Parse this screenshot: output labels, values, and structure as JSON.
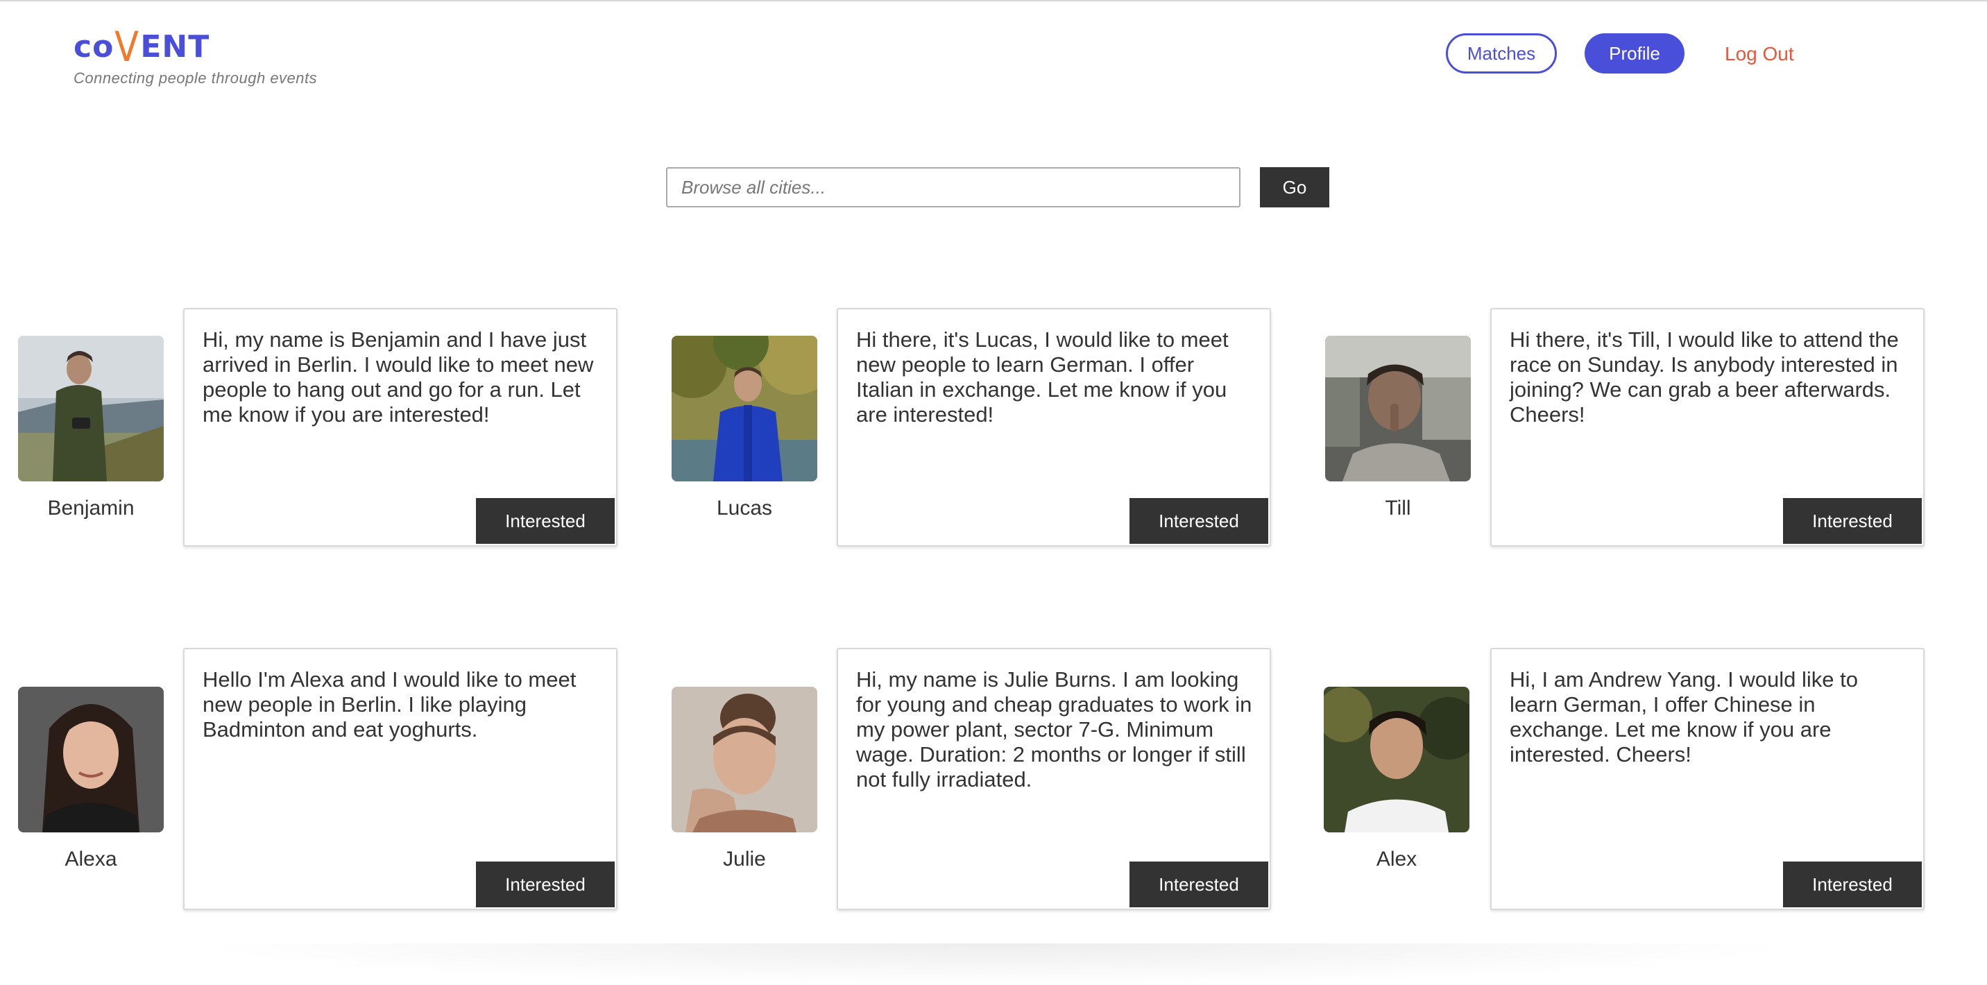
{
  "brand": {
    "logo_prefix": "co",
    "logo_v": "V",
    "logo_suffix": "ENT",
    "tagline": "Connecting people through events",
    "primary_color": "#4a4fd9",
    "accent_color": "#f07a2c"
  },
  "nav": {
    "matches_label": "Matches",
    "profile_label": "Profile",
    "logout_label": "Log Out",
    "logout_color": "#e8553b"
  },
  "search": {
    "placeholder": "Browse all cities...",
    "value": "",
    "go_label": "Go"
  },
  "cards": [
    {
      "name": "Benjamin",
      "message": "Hi, my name is Benjamin and I have just arrived in Berlin. I would like to meet new people to hang out and go for a run. Let me know if you are interested!",
      "button_label": "Interested"
    },
    {
      "name": "Lucas",
      "message": "Hi there, it's Lucas, I would like to meet new people to learn German. I offer Italian in exchange. Let me know if you are interested!",
      "button_label": "Interested"
    },
    {
      "name": "Till",
      "message": "Hi there, it's Till, I would like to attend the race on Sunday. Is anybody interested in joining? We can grab a beer afterwards. Cheers!",
      "button_label": "Interested"
    },
    {
      "name": "Alexa",
      "message": "Hello I'm Alexa and I would like to meet new people in Berlin. I like playing Badminton and eat yoghurts.",
      "button_label": "Interested"
    },
    {
      "name": "Julie",
      "message": "Hi, my name is Julie Burns. I am looking for young and cheap graduates to work in my power plant, sector 7-G. Minimum wage. Duration: 2 months or longer if still not fully irradiated.",
      "button_label": "Interested"
    },
    {
      "name": "Alex",
      "message": "Hi, I am Andrew Yang. I would like to learn German, I offer Chinese in exchange. Let me know if you are interested. Cheers!",
      "button_label": "Interested"
    }
  ]
}
